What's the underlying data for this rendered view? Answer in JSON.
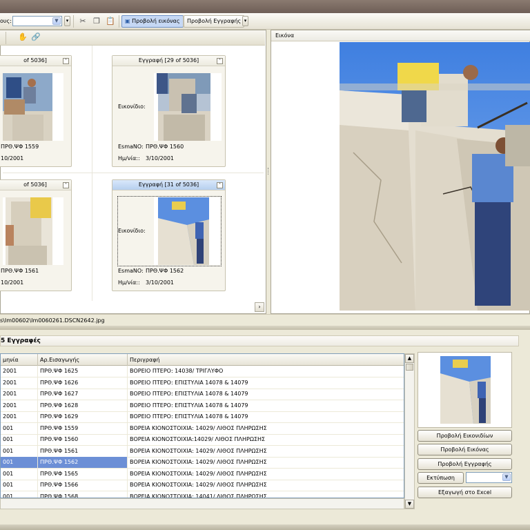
{
  "toolbar": {
    "label": "ους:",
    "combo_value": "",
    "view_image": "Προβολή εικόνας",
    "view_record": "Προβολή Εγγραφής",
    "icons": [
      "cut-icon",
      "copy-icon",
      "paste-icon",
      "image-view-icon"
    ]
  },
  "left_panel": {
    "cards": [
      {
        "header": "of 5036]",
        "field_label": "",
        "esma_label": "",
        "esma_value": "ΠΡΘ.ΨΦ 1559",
        "date_label": "",
        "date_value": "10/2001",
        "selected": false
      },
      {
        "header": "Εγγραφή [29 of 5036]",
        "field_label": "Εικονίδιο:",
        "esma_label": "EsmaNO:",
        "esma_value": "ΠΡΘ.ΨΦ 1560",
        "date_label": "Ημ/νία::",
        "date_value": "3/10/2001",
        "selected": false
      },
      {
        "header": "of 5036]",
        "field_label": "",
        "esma_label": "",
        "esma_value": "ΠΡΘ.ΨΦ 1561",
        "date_label": "",
        "date_value": "10/2001",
        "selected": false
      },
      {
        "header": "Εγγραφή [31 of 5036]",
        "field_label": "Εικονίδιο:",
        "esma_label": "EsmaNO:",
        "esma_value": "ΠΡΘ.ΨΦ 1562",
        "date_label": "Ημ/νία::",
        "date_value": "3/10/2001",
        "selected": true
      }
    ]
  },
  "right_panel": {
    "title": "Εικόνα"
  },
  "path": "s\\Im00602\\Im0060261.DSCN2642.jpg",
  "records": {
    "title": "5 Εγγραφές",
    "columns": [
      "μηνία",
      "Αρ.Εισαγωγής",
      "Περιγραφή"
    ],
    "rows": [
      {
        "date": "2001",
        "num": "ΠΡΘ.ΨΦ 1625",
        "desc": "ΒΟΡΕΙΟ ΠΤΕΡΟ: 14038/ ΤΡΙΓΛΥΦΟ"
      },
      {
        "date": "2001",
        "num": "ΠΡΘ.ΨΦ 1626",
        "desc": "ΒΟΡΕΙΟ ΠΤΕΡΟ: ΕΠΙΣΤΥΛΙΑ 14078 & 14079"
      },
      {
        "date": "2001",
        "num": "ΠΡΘ.ΨΦ 1627",
        "desc": "ΒΟΡΕΙΟ ΠΤΕΡΟ: ΕΠΙΣΤΥΛΙΑ 14078 & 14079"
      },
      {
        "date": "2001",
        "num": "ΠΡΘ.ΨΦ 1628",
        "desc": "ΒΟΡΕΙΟ ΠΤΕΡΟ: ΕΠΙΣΤΥΛΙΑ 14078 & 14079"
      },
      {
        "date": "2001",
        "num": "ΠΡΘ.ΨΦ 1629",
        "desc": "ΒΟΡΕΙΟ ΠΤΕΡΟ: ΕΠΙΣΤΥΛΙΑ 14078 & 14079"
      },
      {
        "date": "001",
        "num": "ΠΡΘ.ΨΦ 1559",
        "desc": "ΒΟΡΕΙΑ ΚΙΟΝΟΣΤΟΙΧΙΑ: 14029/ ΛΙΘΟΣ ΠΛΗΡΩΣΗΣ"
      },
      {
        "date": "001",
        "num": "ΠΡΘ.ΨΦ 1560",
        "desc": "ΒΟΡΕΙΑ ΚΙΟΝΟΣΤΟΙΧΙΑ:14029/ ΛΙΘΟΣ ΠΛΗΡΩΣΗΣ"
      },
      {
        "date": "001",
        "num": "ΠΡΘ.ΨΦ 1561",
        "desc": "ΒΟΡΕΙΑ ΚΙΟΝΟΣΤΟΙΧΙΑ: 14029/ ΛΙΘΟΣ ΠΛΗΡΩΣΗΣ"
      },
      {
        "date": "001",
        "num": "ΠΡΘ.ΨΦ 1562",
        "desc": "ΒΟΡΕΙΑ ΚΙΟΝΟΣΤΟΙΧΙΑ: 14029/ ΛΙΘΟΣ ΠΛΗΡΩΣΗΣ",
        "selected": true
      },
      {
        "date": "001",
        "num": "ΠΡΘ.ΨΦ 1565",
        "desc": "ΒΟΡΕΙΑ ΚΙΟΝΟΣΤΟΙΧΙΑ: 14029/ ΛΙΘΟΣ ΠΛΗΡΩΣΗΣ"
      },
      {
        "date": "001",
        "num": "ΠΡΘ.ΨΦ 1566",
        "desc": "ΒΟΡΕΙΑ ΚΙΟΝΟΣΤΟΙΧΙΑ: 14029/ ΛΙΘΟΣ ΠΛΗΡΩΣΗΣ"
      },
      {
        "date": "001",
        "num": "ΠΡΘ.ΨΦ 1568",
        "desc": "ΒΟΡΕΙΑ ΚΙΟΝΟΣΤΟΙΧΙΑ: 14041/ ΛΙΘΟΣ ΠΛΗΡΩΣΗΣ"
      }
    ]
  },
  "side_buttons": {
    "thumbnails": "Προβολή Εικονιδίων",
    "image": "Προβολή Εικόνας",
    "record": "Προβολή Εγγραφής",
    "print": "Εκτύπωση",
    "print_option": "",
    "excel": "Εξαγωγή στο Excel"
  },
  "colors": {
    "selection": "#6c8fd6",
    "sky": "#5b8fe0",
    "stone": "#e6e0d2"
  }
}
